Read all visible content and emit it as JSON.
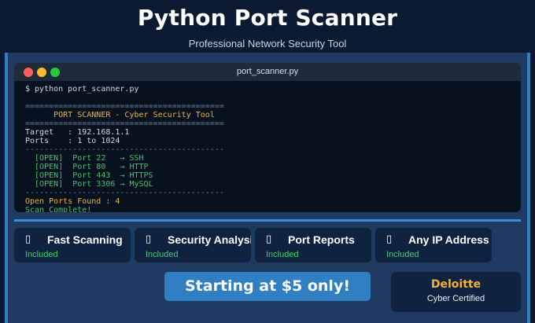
{
  "header": {
    "title": "Python Port Scanner",
    "subtitle": "Professional Network Security Tool"
  },
  "terminal": {
    "window_title": "port_scanner.py",
    "command": "$ python port_scanner.py",
    "separator_double": "==========================================",
    "banner": "      PORT SCANNER - Cyber Security Tool",
    "target": "Target   : 192.168.1.1",
    "ports": "Ports    : 1 to 1024",
    "separator_single": "------------------------------------------",
    "results": [
      "  [OPEN]  Port 22   → SSH",
      "  [OPEN]  Port 80   → HTTP",
      "  [OPEN]  Port 443  → HTTPS",
      "  [OPEN]  Port 3306 → MySQL"
    ],
    "open_count": "Open Ports Found : 4",
    "complete": "Scan Complete!"
  },
  "features": [
    {
      "icon": "lightning-icon",
      "glyph": "▯",
      "title": "Fast Scanning",
      "status": "Included"
    },
    {
      "icon": "shield-icon",
      "glyph": "▯",
      "title": "Security Analysis",
      "status": "Included"
    },
    {
      "icon": "report-icon",
      "glyph": "▯",
      "title": "Port Reports",
      "status": "Included"
    },
    {
      "icon": "globe-icon",
      "glyph": "▯",
      "title": "Any IP Address",
      "status": "Included"
    }
  ],
  "cta": {
    "label": "Starting at $5 only!"
  },
  "badge": {
    "name": "Deloitte",
    "caption": "Cyber Certified"
  },
  "colors": {
    "accent": "#2f7fc2",
    "gold": "#f2b233",
    "green": "#3fcf6a",
    "background": "#0b1a30"
  }
}
